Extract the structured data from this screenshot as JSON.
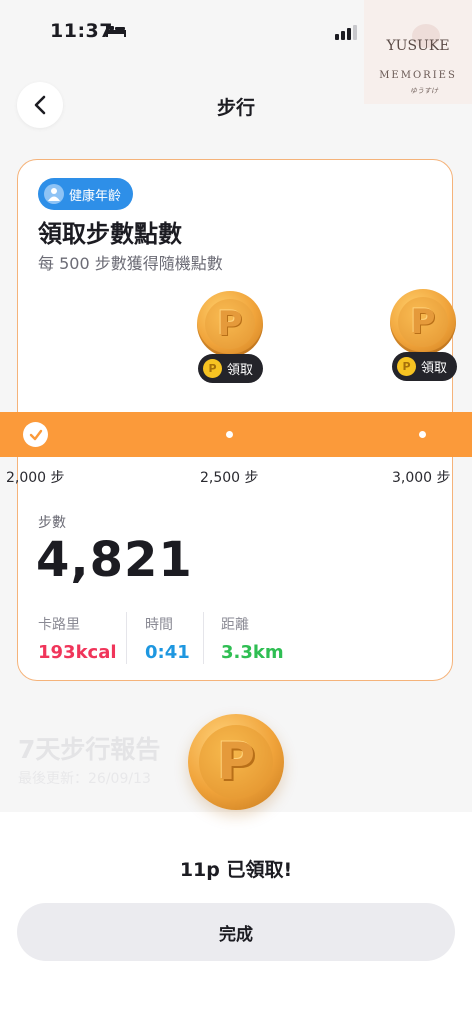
{
  "status_bar": {
    "time": "11:37"
  },
  "watermark": {
    "title": "YUSUKE",
    "subtitle": "MEMORIES",
    "signature": "ゆうすけ"
  },
  "nav": {
    "title": "步行",
    "back_icon": "chevron-left-icon"
  },
  "card": {
    "badge": "健康年齡",
    "title": "領取步數點數",
    "subtitle": "每 500 步數獲得隨機點數",
    "claim_label": "領取",
    "coin_letter": "P",
    "milestones": [
      "2,000 步",
      "2,500 步",
      "3,000 步"
    ],
    "steps_label": "步數",
    "steps_value": "4,821",
    "stats": [
      {
        "label": "卡路里",
        "value": "193kcal",
        "color": "#f0355a"
      },
      {
        "label": "時間",
        "value": "0:41",
        "color": "#1e97e0"
      },
      {
        "label": "距離",
        "value": "3.3km",
        "color": "#2fbe53"
      }
    ]
  },
  "background_section": {
    "title": "7天步行報告",
    "updated": "最後更新：26/09/13"
  },
  "sheet": {
    "coin_letter": "P",
    "message": "11p 已領取!",
    "done_label": "完成"
  },
  "colors": {
    "accent": "#fb9a3a",
    "badge": "#2e8fe8",
    "card_border": "#f5b37a"
  }
}
